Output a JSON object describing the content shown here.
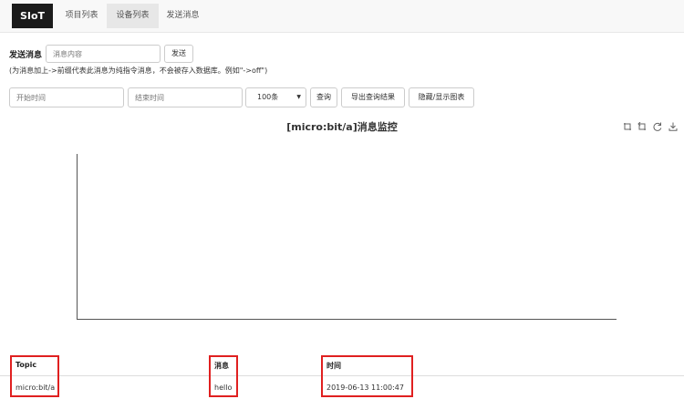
{
  "nav": {
    "brand": "SIoT",
    "items": [
      {
        "label": "项目列表",
        "active": false
      },
      {
        "label": "设备列表",
        "active": true
      },
      {
        "label": "发送消息",
        "active": false
      }
    ]
  },
  "send": {
    "label": "发送消息",
    "placeholder": "消息内容",
    "button": "发送",
    "hint": "(为消息加上->前缀代表此消息为纯指令消息，不会被存入数据库。例如\"->off\")"
  },
  "filter": {
    "start_placeholder": "开始时间",
    "end_placeholder": "结束时间",
    "count_value": "100条",
    "query_button": "查询",
    "export_button": "导出查询结果",
    "toggle_chart_button": "隐藏/显示图表"
  },
  "chart_data": {
    "type": "line",
    "title": "[micro:bit/a]消息监控",
    "series": [],
    "x": [],
    "xlabel": "",
    "ylabel": "",
    "grid": false
  },
  "toolbox": {
    "icons": [
      "zoom-icon",
      "zoom-reset-icon",
      "restore-icon",
      "download-icon"
    ]
  },
  "table": {
    "columns": [
      "Topic",
      "消息",
      "时间"
    ],
    "rows": [
      [
        "micro:bit/a",
        "hello",
        "2019-06-13 11:00:47"
      ]
    ]
  },
  "colors": {
    "brand_bg": "#1b1b1b",
    "highlight_box": "#e02020",
    "axis": "#555555"
  }
}
